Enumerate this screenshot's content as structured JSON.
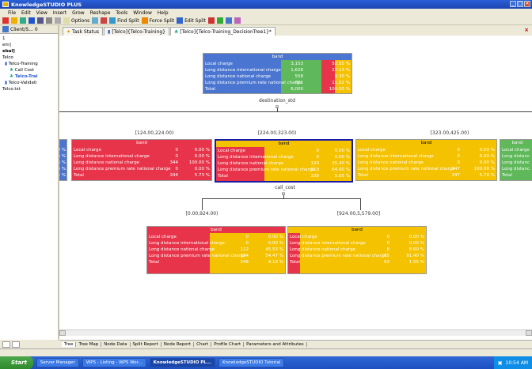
{
  "window": {
    "title": "KnowledgeSTUDIO PLUS"
  },
  "menu": [
    "File",
    "Edit",
    "View",
    "Insert",
    "Grow",
    "Reshape",
    "Tools",
    "Window",
    "Help"
  ],
  "toolbar": {
    "options": "Options",
    "find_split": "Find Split",
    "force_split": "Force Split",
    "edit_split": "Edit Split"
  },
  "left_panel": {
    "header": "Client/S... 0",
    "items": [
      "1",
      "em]",
      "ebal]",
      "Telco",
      "Telco-Training",
      "Call Cost",
      "Telco-Trai",
      "Telco-Validati",
      "Telco.txt"
    ]
  },
  "tabs": [
    "Task Status",
    "[Telco]{Telco-Training}",
    "[Telco]{Telco-Training_DecisionTree1}*"
  ],
  "colors": {
    "blue": "#4a76d1",
    "green": "#5fb85a",
    "red": "#e8344a",
    "orange": "#f5c200",
    "selected_border": "#1a1aa8"
  },
  "root": {
    "band": "band",
    "rows": [
      {
        "label": "Local charge",
        "count": "3,153",
        "pct": "52.55 %"
      },
      {
        "label": "Long distance international charge",
        "count": "1,628",
        "pct": "27.13 %"
      },
      {
        "label": "Long distance national charge",
        "count": "558",
        "pct": "9.30 %"
      },
      {
        "label": "Long distance premium rate national charge",
        "count": "661",
        "pct": "11.02 %"
      },
      {
        "label": "Total",
        "count": "6,000",
        "pct": "100.00 %"
      }
    ],
    "split_var": "destination_std"
  },
  "level1_ranges": [
    "[124.00,224.00)",
    "[224.00,323.00)",
    "[323.00,425.00)"
  ],
  "level1_left_stub": {
    "pcts": [
      "0 %",
      "6 %",
      "6 %",
      "6 %",
      "5 %"
    ]
  },
  "node_a": {
    "band": "band",
    "rows": [
      {
        "label": "Local charge",
        "count": "0",
        "pct": "0.00 %"
      },
      {
        "label": "Long distance international charge",
        "count": "0",
        "pct": "0.00 %"
      },
      {
        "label": "Long distance national charge",
        "count": "344",
        "pct": "100.00 %"
      },
      {
        "label": "Long distance premium rate national charge",
        "count": "0",
        "pct": "0.00 %"
      },
      {
        "label": "Total",
        "count": "344",
        "pct": "5.73 %"
      }
    ]
  },
  "node_b": {
    "band": "band",
    "rows": [
      {
        "label": "Local charge",
        "count": "0",
        "pct": "0.00 %"
      },
      {
        "label": "Long distance international charge",
        "count": "0",
        "pct": "0.00 %"
      },
      {
        "label": "Long distance national charge",
        "count": "120",
        "pct": "35.40 %"
      },
      {
        "label": "Long distance premium rate national charge",
        "count": "219",
        "pct": "64.60 %"
      },
      {
        "label": "Total",
        "count": "339",
        "pct": "5.65 %"
      }
    ],
    "split_var": "call_cost"
  },
  "node_c": {
    "band": "band",
    "rows": [
      {
        "label": "Local charge",
        "count": "0",
        "pct": "0.00 %"
      },
      {
        "label": "Long distance international charge",
        "count": "0",
        "pct": "0.00 %"
      },
      {
        "label": "Long distance national charge",
        "count": "0",
        "pct": "0.00 %"
      },
      {
        "label": "Long distance premium rate national charge",
        "count": "347",
        "pct": "100.00 %"
      },
      {
        "label": "Total",
        "count": "347",
        "pct": "5.78 %"
      }
    ]
  },
  "node_d_stub": {
    "band": "band",
    "labels": [
      "Local charge",
      "Long distanc",
      "Long distanc",
      "Long distanc",
      "Total"
    ]
  },
  "level2_ranges": [
    "[0.00,924.00)",
    "[924.00,5,579.00]"
  ],
  "node_e": {
    "band": "band",
    "rows": [
      {
        "label": "Local charge",
        "count": "0",
        "pct": "0.00 %"
      },
      {
        "label": "Long distance international charge",
        "count": "0",
        "pct": "0.00 %"
      },
      {
        "label": "Long distance national charge",
        "count": "112",
        "pct": "45.53 %"
      },
      {
        "label": "Long distance premium rate national charge",
        "count": "134",
        "pct": "54.47 %"
      },
      {
        "label": "Total",
        "count": "246",
        "pct": "4.10 %"
      }
    ]
  },
  "node_f": {
    "band": "band",
    "rows": [
      {
        "label": "Local charge",
        "count": "0",
        "pct": "0.00 %"
      },
      {
        "label": "Long distance international charge",
        "count": "0",
        "pct": "0.00 %"
      },
      {
        "label": "Long distance national charge",
        "count": "8",
        "pct": "8.60 %"
      },
      {
        "label": "Long distance premium rate national charge",
        "count": "85",
        "pct": "91.40 %"
      },
      {
        "label": "Total",
        "count": "93",
        "pct": "1.55 %"
      }
    ]
  },
  "bottom_tabs": [
    "Tree",
    "Tree Map",
    "Node Data",
    "Split Report",
    "Node Report",
    "Chart",
    "Profile Chart",
    "Parameters and Attributes"
  ],
  "taskbar": {
    "start": "Start",
    "items": [
      "Server Manager",
      "WPS - Listing - WPS Wor...",
      "KnowledgeSTUDIO PL...",
      "KnowledgeSTUDIO Tutorial"
    ],
    "clock": "10:54 AM"
  }
}
